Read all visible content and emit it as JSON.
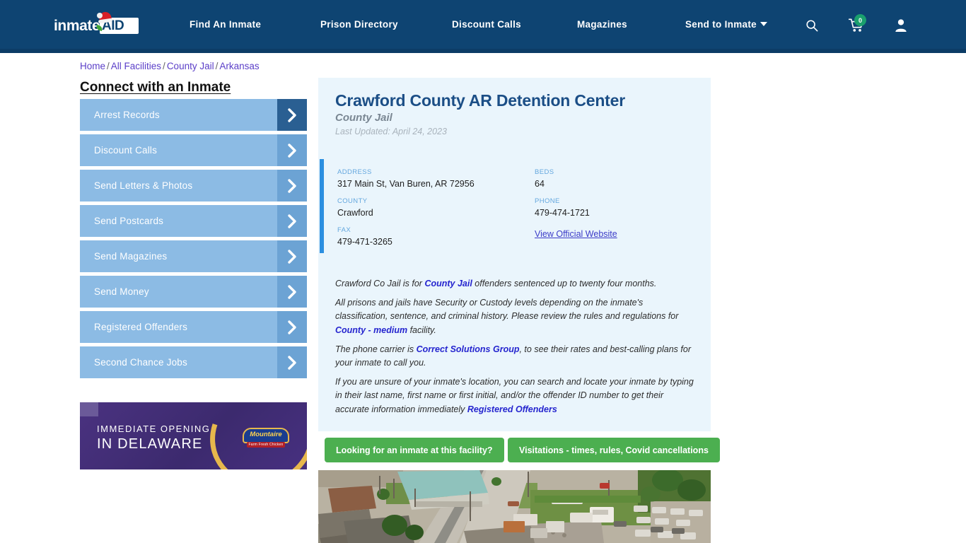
{
  "header": {
    "logo": {
      "text": "inmate",
      "box_text": "AID",
      "hat_icon": "santa-hat-icon",
      "leaf_icon": "leaf-icon"
    },
    "nav": [
      {
        "label": "Find An Inmate",
        "name": "nav-find-an-inmate"
      },
      {
        "label": "Prison Directory",
        "name": "nav-prison-directory"
      },
      {
        "label": "Discount Calls",
        "name": "nav-discount-calls"
      },
      {
        "label": "Magazines",
        "name": "nav-magazines"
      },
      {
        "label": "Send to Inmate",
        "name": "nav-send-to-inmate",
        "has_caret": true
      }
    ],
    "icons": {
      "search": "search-icon",
      "cart": "cart-icon",
      "user": "user-icon"
    },
    "cart_count": "0",
    "colors": {
      "navbar_bg": "#0e4472",
      "cart_badge": "#1aa06d"
    }
  },
  "breadcrumb": {
    "items": [
      "Home",
      "All Facilities",
      "County Jail",
      "Arkansas"
    ],
    "separator": "/"
  },
  "sidebar": {
    "title": "Connect with an Inmate",
    "items": [
      {
        "label": "Arrest Records"
      },
      {
        "label": "Discount Calls"
      },
      {
        "label": "Send Letters & Photos"
      },
      {
        "label": "Send Postcards"
      },
      {
        "label": "Send Magazines"
      },
      {
        "label": "Send Money"
      },
      {
        "label": "Registered Offenders"
      },
      {
        "label": "Second Chance Jobs"
      }
    ],
    "ad": {
      "line1": "IMMEDIATE OPENING",
      "line2": "IN DELAWARE",
      "brand": "Mountaire",
      "brand_sub": "Farm Fresh Chicken"
    }
  },
  "facility": {
    "title": "Crawford County AR Detention Center",
    "type": "County Jail",
    "last_updated": "Last Updated: April 24, 2023",
    "info": {
      "address_label": "ADDRESS",
      "address_value": "317 Main St, Van Buren, AR 72956",
      "county_label": "COUNTY",
      "county_value": "Crawford",
      "fax_label": "FAX",
      "fax_value": "479-471-3265",
      "beds_label": "BEDS",
      "beds_value": "64",
      "phone_label": "PHONE",
      "phone_value": "479-474-1721",
      "website_link": "View Official Website"
    },
    "paragraphs": {
      "p1_a": "Crawford Co Jail is for ",
      "p1_link": "County Jail",
      "p1_b": " offenders sentenced up to twenty four months.",
      "p2_a": "All prisons and jails have Security or Custody levels depending on the inmate's classification, sentence, and criminal history. Please review the rules and regulations for ",
      "p2_link": "County - medium",
      "p2_b": " facility.",
      "p3_a": "The phone carrier is ",
      "p3_link": "Correct Solutions Group",
      "p3_b": ", to see their rates and best-calling plans for your inmate to call you.",
      "p4_a": "If you are unsure of your inmate's location, you can search and locate your inmate by typing in their last name, first name or first initial, and/or the offender ID number to get their accurate information immediately ",
      "p4_link": "Registered Offenders"
    },
    "buttons": [
      {
        "label": "Looking for an inmate at this facility?"
      },
      {
        "label": "Visitations - times, rules, Covid cancellations"
      }
    ],
    "photo_alt": "aerial-facility-photo"
  }
}
